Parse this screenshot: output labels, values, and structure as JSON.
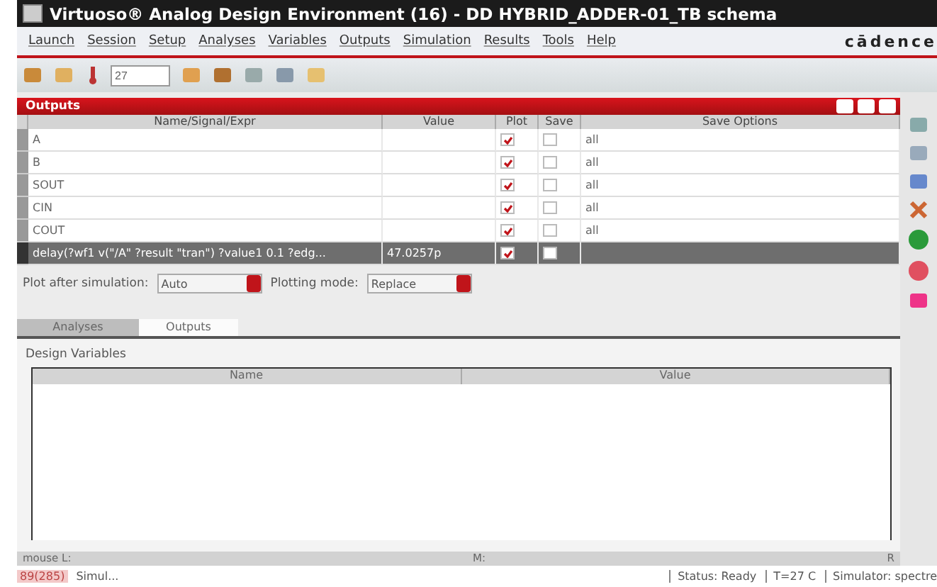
{
  "window": {
    "title": "Virtuoso® Analog Design Environment (16) - DD HYBRID_ADDER-01_TB schema"
  },
  "menu": [
    "Launch",
    "Session",
    "Setup",
    "Analyses",
    "Variables",
    "Outputs",
    "Simulation",
    "Results",
    "Tools",
    "Help"
  ],
  "brand": "cādence",
  "toolbar": {
    "temperature": "27"
  },
  "outputs": {
    "title": "Outputs",
    "columns": [
      "Name/Signal/Expr",
      "Value",
      "Plot",
      "Save",
      "Save Options"
    ],
    "rows": [
      {
        "name": "A",
        "value": "",
        "plot": true,
        "save": false,
        "save_options": "all",
        "selected": false
      },
      {
        "name": "B",
        "value": "",
        "plot": true,
        "save": false,
        "save_options": "all",
        "selected": false
      },
      {
        "name": "SOUT",
        "value": "",
        "plot": true,
        "save": false,
        "save_options": "all",
        "selected": false
      },
      {
        "name": "CIN",
        "value": "",
        "plot": true,
        "save": false,
        "save_options": "all",
        "selected": false
      },
      {
        "name": "COUT",
        "value": "",
        "plot": true,
        "save": false,
        "save_options": "all",
        "selected": false
      },
      {
        "name": "delay(?wf1 v(\"/A\" ?result \"tran\") ?value1 0.1 ?edg...",
        "value": "47.0257p",
        "plot": true,
        "save": false,
        "save_options": "",
        "selected": true
      }
    ]
  },
  "plot_after_label": "Plot after simulation:",
  "plot_after": "Auto",
  "plotting_mode_label": "Plotting mode:",
  "plotting_mode": "Replace",
  "tabs": [
    {
      "label": "Analyses",
      "selected": false
    },
    {
      "label": "Outputs",
      "selected": true
    }
  ],
  "design_variables": {
    "title": "Design Variables",
    "columns": [
      "Name",
      "Value"
    ]
  },
  "mouse_bar": [
    "mouse L:",
    "M:",
    "R"
  ],
  "status_bar": {
    "code": "89(285)",
    "message": "Simul...",
    "status": "Status: Ready",
    "temp": "T=27  C",
    "simulator": "Simulator: spectre"
  }
}
